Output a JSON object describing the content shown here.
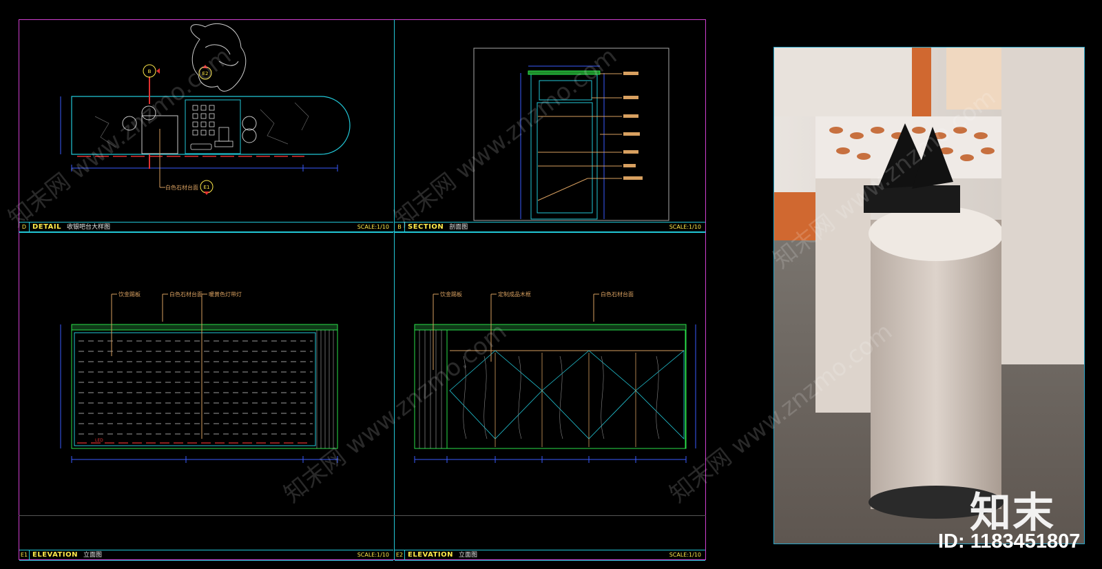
{
  "panels": {
    "detail": {
      "tag": "D",
      "keyword": "DETAIL",
      "name": "收银吧台大样图",
      "scale": "SCALE:1/10"
    },
    "section": {
      "tag": "B",
      "keyword": "SECTION",
      "name": "剖面图",
      "scale": "SCALE:1/10"
    },
    "elevation1": {
      "tag": "E1",
      "keyword": "ELEVATION",
      "name": "立面图",
      "scale": "SCALE:1/10"
    },
    "elevation2": {
      "tag": "E2",
      "keyword": "ELEVATION",
      "name": "立面图",
      "scale": "SCALE:1/10"
    }
  },
  "plan_labels": {
    "callout_b": "B",
    "callout_e2": "E2",
    "callout_e1": "E1",
    "leader": "白色石材台面"
  },
  "elevation1_labels": [
    "饮金踢板",
    "白色石材台面",
    "暖黄色灯带灯"
  ],
  "elevation2_labels": [
    "饮金踢板",
    "定制成品木框",
    "白色石材台面"
  ],
  "led_label": "LED",
  "brand": {
    "logo_text": "知末",
    "id_text": "ID: 1183451807"
  },
  "watermark": "知末网 www.znzmo.com",
  "colors": {
    "frame": "#d13fd1",
    "divider": "#22c8d8",
    "title": "#ffe94a",
    "dim": "#3a5bff",
    "led": "#e03030"
  }
}
